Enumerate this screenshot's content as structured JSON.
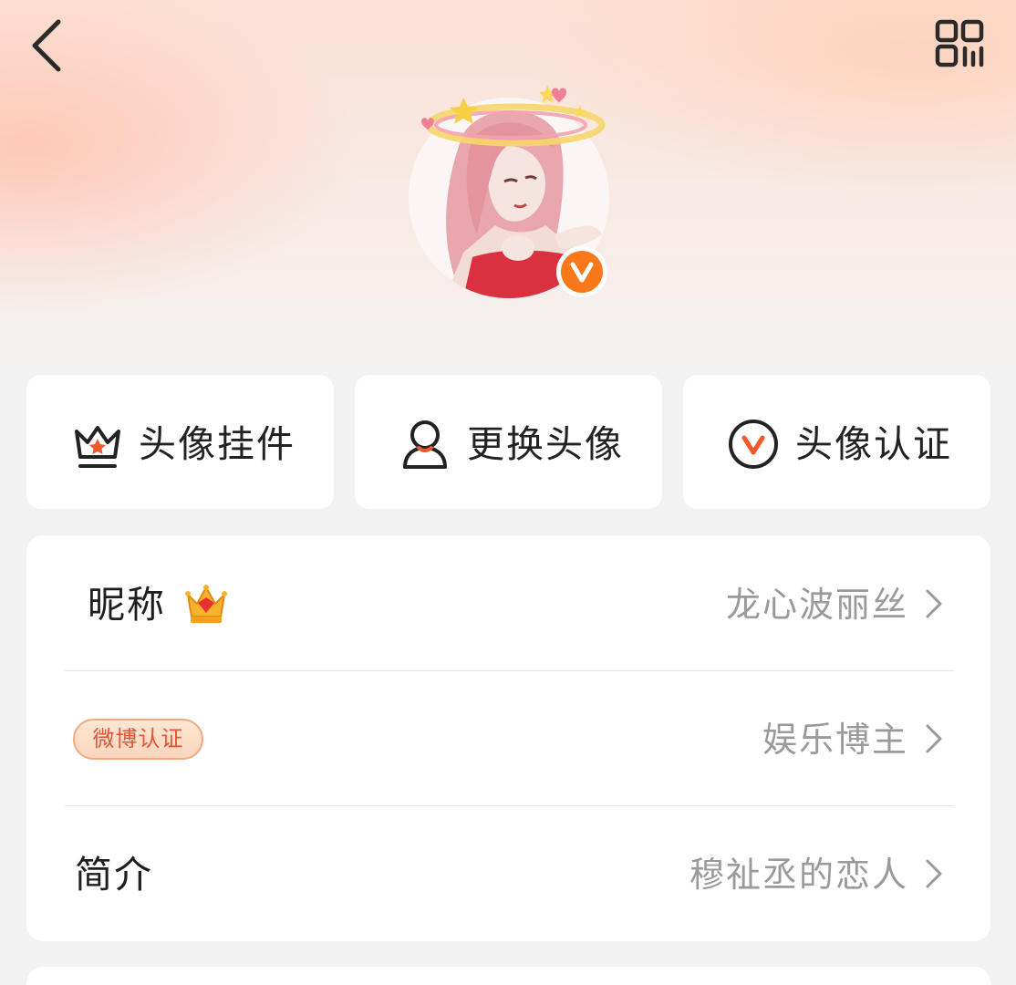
{
  "actions": [
    {
      "label": "头像挂件",
      "icon": "pendant-crown-icon"
    },
    {
      "label": "更换头像",
      "icon": "person-icon"
    },
    {
      "label": "头像认证",
      "icon": "verify-v-icon"
    }
  ],
  "profile": {
    "nickname_label": "昵称",
    "nickname_value": "龙心波丽丝",
    "certification_badge": "微博认证",
    "certification_value": "娱乐博主",
    "bio_label": "简介",
    "bio_value": "穆祉丞的恋人"
  },
  "colors": {
    "accent_orange": "#f9791a",
    "badge_text": "#e0553a",
    "value_gray": "#9a9a9a"
  }
}
